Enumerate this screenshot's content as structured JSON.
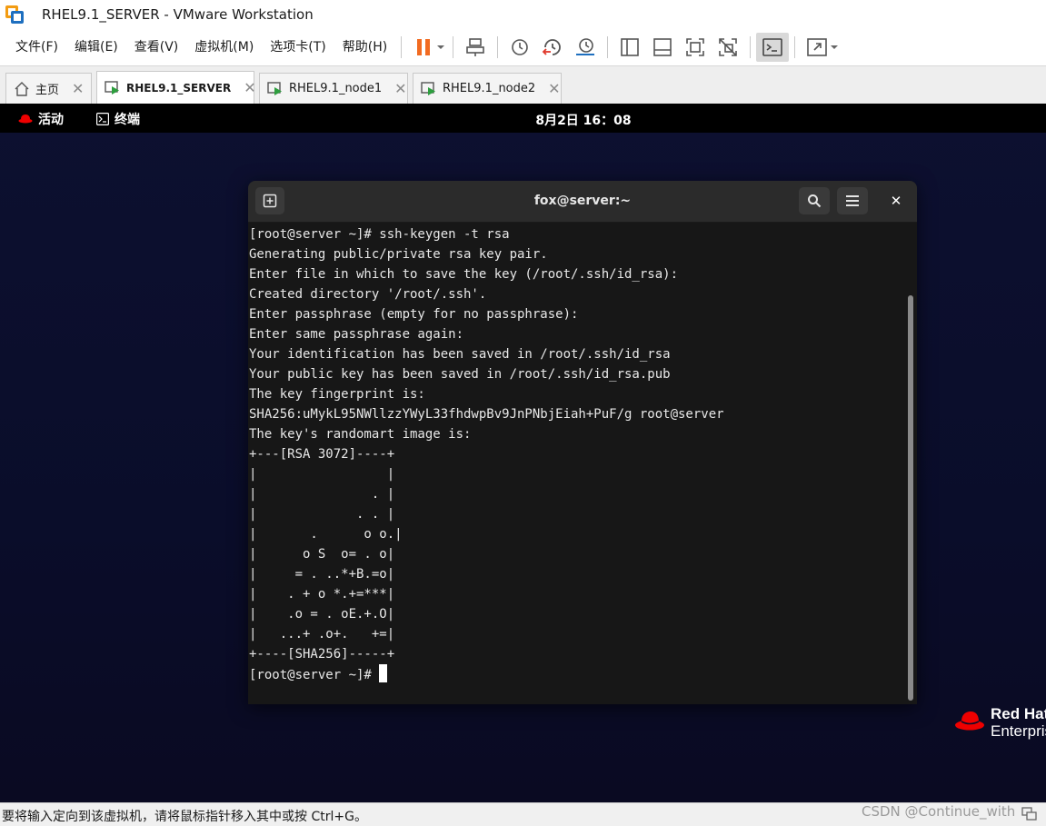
{
  "window": {
    "title": "RHEL9.1_SERVER - VMware Workstation"
  },
  "menubar": {
    "items": [
      {
        "label": "文件(F)"
      },
      {
        "label": "编辑(E)"
      },
      {
        "label": "查看(V)"
      },
      {
        "label": "虚拟机(M)"
      },
      {
        "label": "选项卡(T)"
      },
      {
        "label": "帮助(H)"
      }
    ]
  },
  "toolbar": {
    "icons": [
      "pause-icon",
      "send-keys-icon",
      "snapshot-icon",
      "revert-snapshot-icon",
      "snapshot-manager-icon",
      "library-icon",
      "thumbnail-icon",
      "fullscreen-icon",
      "unity-icon",
      "console-view-icon",
      "stretch-icon"
    ],
    "accent": "#f26b21"
  },
  "tabs": [
    {
      "label": "主页",
      "active": false
    },
    {
      "label": "RHEL9.1_SERVER",
      "active": true
    },
    {
      "label": "RHEL9.1_node1",
      "active": false
    },
    {
      "label": "RHEL9.1_node2",
      "active": false
    }
  ],
  "gnome": {
    "activities": "活动",
    "terminal_app": "终端",
    "clock": "8月2日  16：08"
  },
  "terminal": {
    "title": "fox@server:~",
    "lines": [
      "[root@server ~]# ssh-keygen -t rsa",
      "Generating public/private rsa key pair.",
      "Enter file in which to save the key (/root/.ssh/id_rsa):",
      "Created directory '/root/.ssh'.",
      "Enter passphrase (empty for no passphrase):",
      "Enter same passphrase again:",
      "Your identification has been saved in /root/.ssh/id_rsa",
      "Your public key has been saved in /root/.ssh/id_rsa.pub",
      "The key fingerprint is:",
      "SHA256:uMykL95NWllzzYWyL33fhdwpBv9JnPNbjEiah+PuF/g root@server",
      "The key's randomart image is:",
      "+---[RSA 3072]----+",
      "|                 |",
      "|               . |",
      "|             . . |",
      "|       .      o o.|",
      "|      o S  o= . o|",
      "|     = . ..*+B.=o|",
      "|    . + o *.+=***|",
      "|    .o = . oE.+.O|",
      "|   ...+ .o+.   +=|",
      "+----[SHA256]-----+"
    ],
    "prompt": "[root@server ~]# "
  },
  "branding": {
    "line1": "Red Hat",
    "line2": "Enterprise",
    "color": "#ee0000"
  },
  "statusbar": {
    "text": "要将输入定向到该虚拟机，请将鼠标指针移入其中或按 Ctrl+G。",
    "watermark": "CSDN @Continue_with"
  }
}
